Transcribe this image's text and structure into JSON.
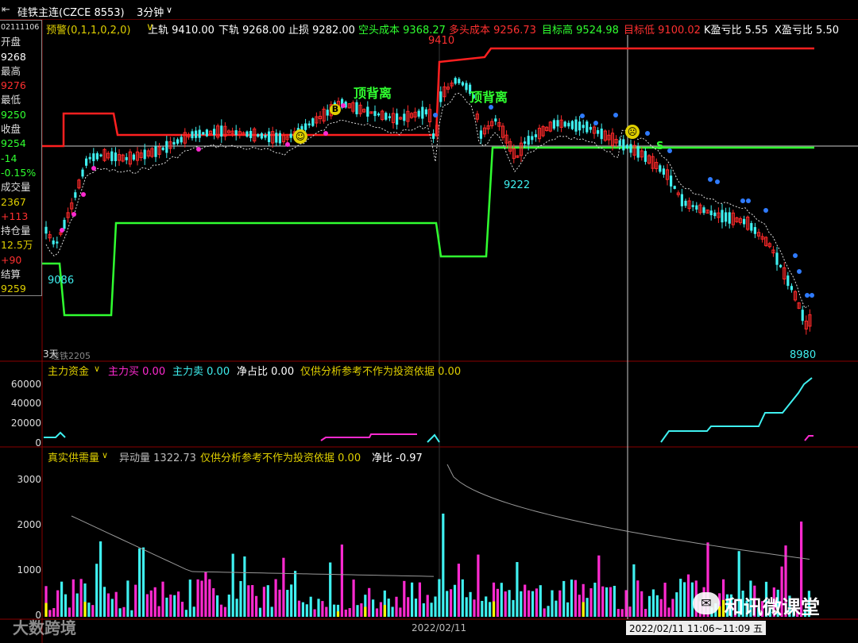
{
  "titlebar": {
    "icon": "chart-window-icon",
    "symbol": "硅铁主连(CZCE 8553)",
    "period": "3分钟",
    "period_arrow": "∨"
  },
  "infobar": {
    "indicator": "预警(0,1,1,0,2,0)",
    "upper_label": "上轨",
    "upper_value": "9410.00",
    "lower_label": "下轨",
    "lower_value": "9268.00",
    "stop_label": "止损",
    "stop_value": "9282.00",
    "short_cost_label": "空头成本",
    "short_cost_value": "9368.27",
    "long_cost_label": "多头成本",
    "long_cost_value": "9256.73",
    "target_high_label": "目标高",
    "target_high_value": "9524.98",
    "target_low_label": "目标低",
    "target_low_value": "9100.02",
    "k_ratio_label": "K盈亏比",
    "k_ratio_value": "5.55",
    "x_ratio_label": "X盈亏比",
    "x_ratio_value": "5.50"
  },
  "sidepanel": {
    "date": "02111106",
    "open_label": "开盘",
    "open": "9268",
    "high_label": "最高",
    "high": "9276",
    "low_label": "最低",
    "low": "9250",
    "close_label": "收盘",
    "close": "9254",
    "change": "-14",
    "change_pct": "-0.15%",
    "volume_label": "成交量",
    "volume": "2367",
    "volume_change": "+113",
    "oi_label": "持仓量",
    "oi": "12.5万",
    "oi_change": "+90",
    "settle_label": "结算",
    "settle": "9259"
  },
  "main_chart": {
    "annotations": {
      "peak": "9410",
      "low_left": "9086",
      "mid_low": "9222",
      "last_low": "8980",
      "divergence1": "顶背离",
      "divergence2": "顶背离",
      "footer": "3天",
      "footer2": "硅铁2205",
      "marker_b": "B",
      "marker_s": "S"
    }
  },
  "panel2": {
    "name": "主力资金",
    "buy_label": "主力买",
    "buy_value": "0.00",
    "sell_label": "主力卖",
    "sell_value": "0.00",
    "net_label": "净占比",
    "net_value": "0.00",
    "note": "仅供分析参考不作为投资依据",
    "note_value": "0.00",
    "y_ticks": [
      "60000",
      "40000",
      "20000",
      "0"
    ]
  },
  "panel3": {
    "name": "真实供需量",
    "abn_label": "异动量",
    "abn_value": "1322.73",
    "note": "仅供分析参考不作为投资依据",
    "note_value": "0.00",
    "net_label": "净比",
    "net_value": "-0.97",
    "y_ticks": [
      "3000",
      "2000",
      "1000",
      "0"
    ]
  },
  "xaxis": {
    "date1": "2022/02/11",
    "cursor": "2022/02/11 11:06~11:09 五"
  },
  "watermarks": {
    "left": "大数跨境",
    "right": "和讯微课堂"
  },
  "colors": {
    "up": "#ff2a2a",
    "down": "#3ff0f0",
    "magenta": "#ff2ad0",
    "red_line": "#ff2020",
    "green_line": "#30ff30",
    "blue_dot": "#2f7bff"
  }
}
